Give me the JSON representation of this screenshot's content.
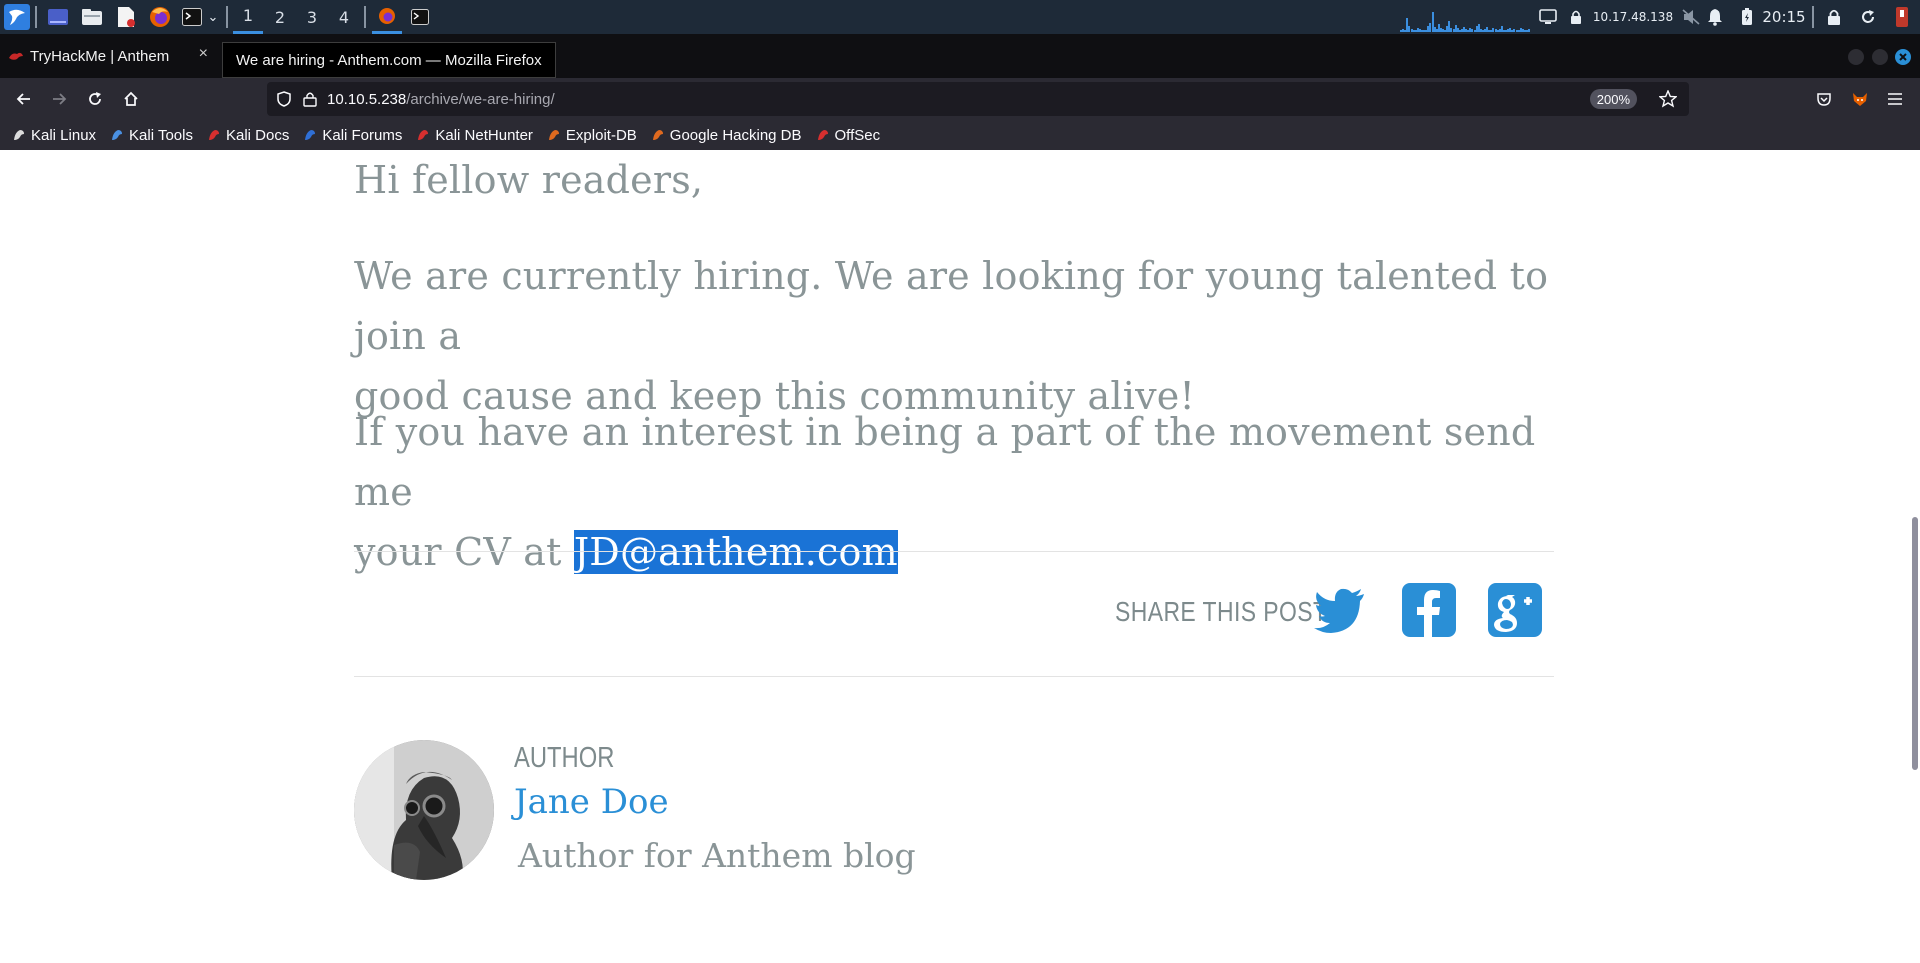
{
  "panel": {
    "workspaces": [
      "1",
      "2",
      "3",
      "4"
    ],
    "active_workspace": "1",
    "ip_address": "10.17.48.138",
    "clock": "20:15",
    "icons": [
      "kali-menu-icon",
      "desktop-icon",
      "file-manager-icon",
      "text-editor-icon",
      "firefox-icon",
      "terminal-icon",
      "chevron-down-icon"
    ],
    "accent": "#3b8fe0"
  },
  "tabs": {
    "inactive_tab_label": "TryHackMe | Anthem",
    "window_title": "We are hiring - Anthem.com — Mozilla Firefox",
    "close_glyph": "×"
  },
  "nav": {
    "url_host": "10.10.5.238",
    "url_path": "/archive/we-are-hiring/",
    "zoom": "200%"
  },
  "bookmarks": [
    {
      "label": "Kali Linux",
      "icon": "kali-icon",
      "color": "#dcdcdc"
    },
    {
      "label": "Kali Tools",
      "icon": "kali-tools-icon",
      "color": "#4a90e2"
    },
    {
      "label": "Kali Docs",
      "icon": "kali-docs-icon",
      "color": "#d62f2f"
    },
    {
      "label": "Kali Forums",
      "icon": "kali-forums-icon",
      "color": "#2f6fd6"
    },
    {
      "label": "Kali NetHunter",
      "icon": "nethunter-icon",
      "color": "#d62f2f"
    },
    {
      "label": "Exploit-DB",
      "icon": "exploit-db-icon",
      "color": "#e06a1f"
    },
    {
      "label": "Google Hacking DB",
      "icon": "ghdb-icon",
      "color": "#e06a1f"
    },
    {
      "label": "OffSec",
      "icon": "offsec-icon",
      "color": "#d62f2f"
    }
  ],
  "article": {
    "greeting": "Hi fellow readers,",
    "para1_line1": "We are currently hiring. We are looking for young talented to join a",
    "para1_line2": "good cause and keep this community alive!",
    "para2_line1": "If you have an interest in being a part of the movement send me",
    "para2_line2_prefix": "your CV at ",
    "email": "JD@anthem.com"
  },
  "share": {
    "label": "SHARE THIS POST",
    "accent": "#2a8fd6"
  },
  "author": {
    "label": "AUTHOR",
    "name": "Jane Doe",
    "bio": "Author for Anthem blog"
  }
}
